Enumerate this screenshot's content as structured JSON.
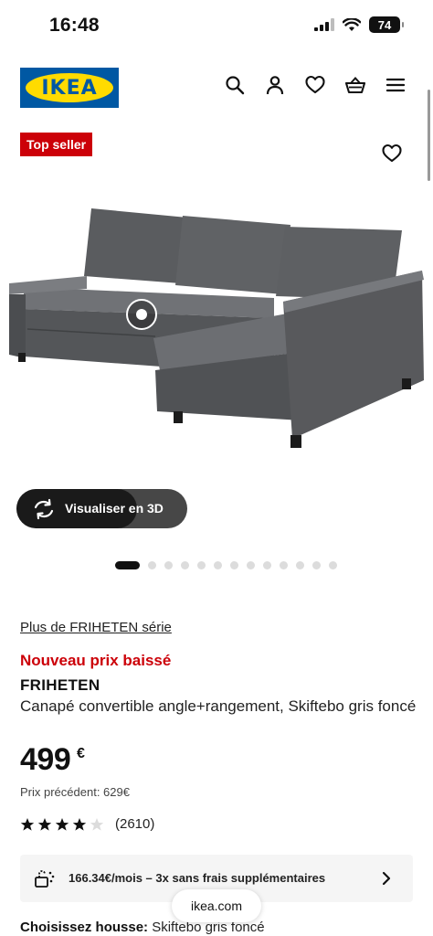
{
  "status_bar": {
    "time": "16:48",
    "battery": "74"
  },
  "header": {
    "logo": "IKEA",
    "icons": [
      "search-icon",
      "account-icon",
      "heart-icon",
      "basket-icon",
      "menu-icon"
    ]
  },
  "badge": "Top seller",
  "image": {
    "has_3d_hotspot": true
  },
  "viz3d": {
    "label": "Visualiser en 3D"
  },
  "carousel": {
    "total": 13,
    "active": 1
  },
  "product": {
    "series_link": "Plus de FRIHETEN série",
    "new_price_label": "Nouveau prix baissé",
    "name": "FRIHETEN",
    "description": "Canapé convertible angle+rangement, Skiftebo gris foncé",
    "price": "499",
    "currency": "€",
    "previous_price": "Prix précédent: 629€",
    "rating": 4,
    "rating_max": 5,
    "review_count": "(2610)"
  },
  "finance": {
    "text": "166.34€/mois – 3x sans frais supplémentaires"
  },
  "cover": {
    "label": "Choisissez housse:",
    "value": "Skiftebo gris foncé"
  },
  "browser": {
    "url": "ikea.com"
  },
  "colors": {
    "ikea_blue": "#0058a3",
    "ikea_yellow": "#ffdb00",
    "sale_red": "#cc0008"
  }
}
